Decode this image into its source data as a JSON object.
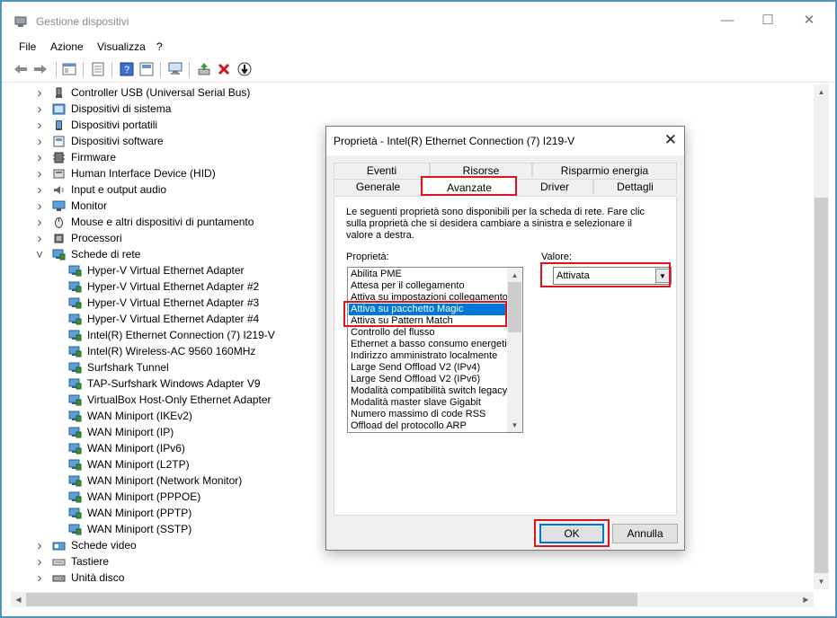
{
  "window": {
    "title": "Gestione dispositivi"
  },
  "menu": [
    "File",
    "Azione",
    "Visualizza",
    "?"
  ],
  "tree": [
    {
      "label": "Controller USB (Universal Serial Bus)",
      "icon": "usb-controller-icon",
      "level": 0,
      "expanded": false
    },
    {
      "label": "Dispositivi di sistema",
      "icon": "system-device-icon",
      "level": 0,
      "expanded": false
    },
    {
      "label": "Dispositivi portatili",
      "icon": "portable-device-icon",
      "level": 0,
      "expanded": false
    },
    {
      "label": "Dispositivi software",
      "icon": "software-device-icon",
      "level": 0,
      "expanded": false
    },
    {
      "label": "Firmware",
      "icon": "firmware-icon",
      "level": 0,
      "expanded": false
    },
    {
      "label": "Human Interface Device (HID)",
      "icon": "hid-icon",
      "level": 0,
      "expanded": false
    },
    {
      "label": "Input e output audio",
      "icon": "audio-icon",
      "level": 0,
      "expanded": false
    },
    {
      "label": "Monitor",
      "icon": "monitor-icon",
      "level": 0,
      "expanded": false
    },
    {
      "label": "Mouse e altri dispositivi di puntamento",
      "icon": "mouse-icon",
      "level": 0,
      "expanded": false
    },
    {
      "label": "Processori",
      "icon": "processor-icon",
      "level": 0,
      "expanded": false
    },
    {
      "label": "Schede di rete",
      "icon": "network-adapter-icon",
      "level": 0,
      "expanded": true
    },
    {
      "label": "Hyper-V Virtual Ethernet Adapter",
      "icon": "network-adapter-icon",
      "level": 1
    },
    {
      "label": "Hyper-V Virtual Ethernet Adapter #2",
      "icon": "network-adapter-icon",
      "level": 1
    },
    {
      "label": "Hyper-V Virtual Ethernet Adapter #3",
      "icon": "network-adapter-icon",
      "level": 1
    },
    {
      "label": "Hyper-V Virtual Ethernet Adapter #4",
      "icon": "network-adapter-icon",
      "level": 1
    },
    {
      "label": "Intel(R) Ethernet Connection (7) I219-V",
      "icon": "network-adapter-icon",
      "level": 1
    },
    {
      "label": "Intel(R) Wireless-AC 9560 160MHz",
      "icon": "network-adapter-icon",
      "level": 1
    },
    {
      "label": "Surfshark Tunnel",
      "icon": "network-adapter-icon",
      "level": 1
    },
    {
      "label": "TAP-Surfshark Windows Adapter V9",
      "icon": "network-adapter-icon",
      "level": 1
    },
    {
      "label": "VirtualBox Host-Only Ethernet Adapter",
      "icon": "network-adapter-icon",
      "level": 1
    },
    {
      "label": "WAN Miniport (IKEv2)",
      "icon": "network-adapter-icon",
      "level": 1
    },
    {
      "label": "WAN Miniport (IP)",
      "icon": "network-adapter-icon",
      "level": 1
    },
    {
      "label": "WAN Miniport (IPv6)",
      "icon": "network-adapter-icon",
      "level": 1
    },
    {
      "label": "WAN Miniport (L2TP)",
      "icon": "network-adapter-icon",
      "level": 1
    },
    {
      "label": "WAN Miniport (Network Monitor)",
      "icon": "network-adapter-icon",
      "level": 1
    },
    {
      "label": "WAN Miniport (PPPOE)",
      "icon": "network-adapter-icon",
      "level": 1
    },
    {
      "label": "WAN Miniport (PPTP)",
      "icon": "network-adapter-icon",
      "level": 1
    },
    {
      "label": "WAN Miniport (SSTP)",
      "icon": "network-adapter-icon",
      "level": 1
    },
    {
      "label": "Schede video",
      "icon": "display-adapter-icon",
      "level": 0,
      "expanded": false
    },
    {
      "label": "Tastiere",
      "icon": "keyboard-icon",
      "level": 0,
      "expanded": false
    },
    {
      "label": "Unità disco",
      "icon": "disk-drive-icon",
      "level": 0,
      "expanded": false
    }
  ],
  "dialog": {
    "title": "Proprietà - Intel(R) Ethernet Connection (7) I219-V",
    "tabs_row1": [
      "Eventi",
      "Risorse",
      "Risparmio energia"
    ],
    "tabs_row2": [
      "Generale",
      "Avanzate",
      "Driver",
      "Dettagli"
    ],
    "active_tab": "Avanzate",
    "description": "Le seguenti proprietà sono disponibili per la scheda di rete. Fare clic sulla proprietà che si desidera cambiare a sinistra e selezionare il valore a destra.",
    "property_label": "Proprietà:",
    "value_label": "Valore:",
    "properties": [
      "Abilita PME",
      "Attesa per il collegamento",
      "Attiva su impostazioni collegamento",
      "Attiva su pacchetto Magic",
      "Attiva su Pattern Match",
      "Controllo del flusso",
      "Ethernet a basso consumo energetico",
      "Indirizzo amministrato localmente",
      "Large Send Offload V2 (IPv4)",
      "Large Send Offload V2 (IPv6)",
      "Modalità compatibilità switch legacy",
      "Modalità master slave Gigabit",
      "Numero massimo di code RSS",
      "Offload del protocollo ARP"
    ],
    "selected_property": "Attiva su pacchetto Magic",
    "value": "Attivata",
    "ok_label": "OK",
    "cancel_label": "Annulla"
  },
  "colors": {
    "highlight": "#0078d7",
    "annotation": "#e0141e",
    "desktop": "#1ea0ee"
  }
}
